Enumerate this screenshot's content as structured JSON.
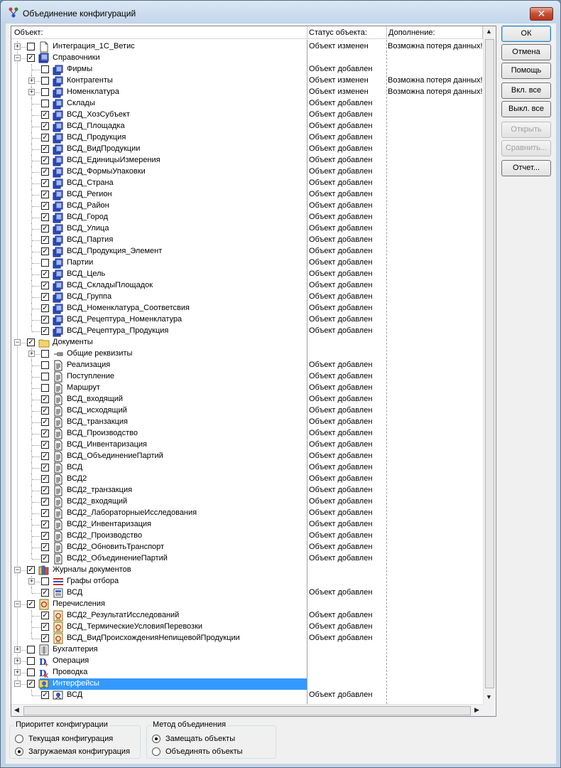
{
  "window": {
    "title": "Объединение конфигураций",
    "close_label": "✕"
  },
  "tree": {
    "columns": [
      "Объект:",
      "Статус объекта:",
      "Дополнение:"
    ],
    "rows": [
      {
        "level": 0,
        "exp": "+",
        "cb": false,
        "icon": "file",
        "name": "Интеграция_1С_Ветис",
        "status": "Объект изменен",
        "extra": "Возможна потеря данных!!"
      },
      {
        "level": 0,
        "exp": "-",
        "cb": true,
        "icon": "catalog-folder",
        "name": "Справочники",
        "status": "",
        "extra": ""
      },
      {
        "level": 1,
        "exp": "",
        "cb": false,
        "icon": "catalog",
        "name": "Фирмы",
        "status": "Объект добавлен",
        "extra": ""
      },
      {
        "level": 1,
        "exp": "+",
        "cb": false,
        "icon": "catalog",
        "name": "Контрагенты",
        "status": "Объект изменен",
        "extra": "Возможна потеря данных!!"
      },
      {
        "level": 1,
        "exp": "+",
        "cb": false,
        "icon": "catalog",
        "name": "Номенклатура",
        "status": "Объект изменен",
        "extra": "Возможна потеря данных!!"
      },
      {
        "level": 1,
        "exp": "",
        "cb": false,
        "icon": "catalog",
        "name": "Склады",
        "status": "Объект добавлен",
        "extra": ""
      },
      {
        "level": 1,
        "exp": "",
        "cb": true,
        "icon": "catalog",
        "name": "ВСД_ХозСубъект",
        "status": "Объект добавлен",
        "extra": ""
      },
      {
        "level": 1,
        "exp": "",
        "cb": true,
        "icon": "catalog",
        "name": "ВСД_Площадка",
        "status": "Объект добавлен",
        "extra": ""
      },
      {
        "level": 1,
        "exp": "",
        "cb": true,
        "icon": "catalog",
        "name": "ВСД_Продукция",
        "status": "Объект добавлен",
        "extra": ""
      },
      {
        "level": 1,
        "exp": "",
        "cb": true,
        "icon": "catalog",
        "name": "ВСД_ВидПродукции",
        "status": "Объект добавлен",
        "extra": ""
      },
      {
        "level": 1,
        "exp": "",
        "cb": true,
        "icon": "catalog",
        "name": "ВСД_ЕдиницыИзмерения",
        "status": "Объект добавлен",
        "extra": ""
      },
      {
        "level": 1,
        "exp": "",
        "cb": true,
        "icon": "catalog",
        "name": "ВСД_ФормыУпаковки",
        "status": "Объект добавлен",
        "extra": ""
      },
      {
        "level": 1,
        "exp": "",
        "cb": true,
        "icon": "catalog",
        "name": "ВСД_Страна",
        "status": "Объект добавлен",
        "extra": ""
      },
      {
        "level": 1,
        "exp": "",
        "cb": true,
        "icon": "catalog",
        "name": "ВСД_Регион",
        "status": "Объект добавлен",
        "extra": ""
      },
      {
        "level": 1,
        "exp": "",
        "cb": true,
        "icon": "catalog",
        "name": "ВСД_Район",
        "status": "Объект добавлен",
        "extra": ""
      },
      {
        "level": 1,
        "exp": "",
        "cb": true,
        "icon": "catalog",
        "name": "ВСД_Город",
        "status": "Объект добавлен",
        "extra": ""
      },
      {
        "level": 1,
        "exp": "",
        "cb": true,
        "icon": "catalog",
        "name": "ВСД_Улица",
        "status": "Объект добавлен",
        "extra": ""
      },
      {
        "level": 1,
        "exp": "",
        "cb": true,
        "icon": "catalog",
        "name": "ВСД_Партия",
        "status": "Объект добавлен",
        "extra": ""
      },
      {
        "level": 1,
        "exp": "",
        "cb": true,
        "icon": "catalog",
        "name": "ВСД_Продукция_Элемент",
        "status": "Объект добавлен",
        "extra": ""
      },
      {
        "level": 1,
        "exp": "",
        "cb": false,
        "icon": "catalog",
        "name": "Партии",
        "status": "Объект добавлен",
        "extra": ""
      },
      {
        "level": 1,
        "exp": "",
        "cb": true,
        "icon": "catalog",
        "name": "ВСД_Цель",
        "status": "Объект добавлен",
        "extra": ""
      },
      {
        "level": 1,
        "exp": "",
        "cb": true,
        "icon": "catalog",
        "name": "ВСД_СкладыПлощадок",
        "status": "Объект добавлен",
        "extra": ""
      },
      {
        "level": 1,
        "exp": "",
        "cb": true,
        "icon": "catalog",
        "name": "ВСД_Группа",
        "status": "Объект добавлен",
        "extra": ""
      },
      {
        "level": 1,
        "exp": "",
        "cb": true,
        "icon": "catalog",
        "name": "ВСД_Номенклатура_Соответсвия",
        "status": "Объект добавлен",
        "extra": ""
      },
      {
        "level": 1,
        "exp": "",
        "cb": true,
        "icon": "catalog",
        "name": "ВСД_Рецептура_Номенклатура",
        "status": "Объект добавлен",
        "extra": ""
      },
      {
        "level": 1,
        "exp": "",
        "cb": true,
        "icon": "catalog",
        "name": "ВСД_Рецептура_Продукция",
        "status": "Объект добавлен",
        "extra": ""
      },
      {
        "level": 0,
        "exp": "-",
        "cb": true,
        "icon": "folder",
        "name": "Документы",
        "status": "",
        "extra": ""
      },
      {
        "level": 1,
        "exp": "+",
        "cb": false,
        "icon": "attribute",
        "name": "Общие реквизиты",
        "status": "",
        "extra": ""
      },
      {
        "level": 1,
        "exp": "",
        "cb": false,
        "icon": "document",
        "name": "Реализация",
        "status": "Объект добавлен",
        "extra": ""
      },
      {
        "level": 1,
        "exp": "",
        "cb": false,
        "icon": "document",
        "name": "Поступление",
        "status": "Объект добавлен",
        "extra": ""
      },
      {
        "level": 1,
        "exp": "",
        "cb": false,
        "icon": "document",
        "name": "Маршрут",
        "status": "Объект добавлен",
        "extra": ""
      },
      {
        "level": 1,
        "exp": "",
        "cb": true,
        "icon": "document",
        "name": "ВСД_входящий",
        "status": "Объект добавлен",
        "extra": ""
      },
      {
        "level": 1,
        "exp": "",
        "cb": true,
        "icon": "document",
        "name": "ВСД_исходящий",
        "status": "Объект добавлен",
        "extra": ""
      },
      {
        "level": 1,
        "exp": "",
        "cb": true,
        "icon": "document",
        "name": "ВСД_транзакция",
        "status": "Объект добавлен",
        "extra": ""
      },
      {
        "level": 1,
        "exp": "",
        "cb": true,
        "icon": "document",
        "name": "ВСД_Производство",
        "status": "Объект добавлен",
        "extra": ""
      },
      {
        "level": 1,
        "exp": "",
        "cb": true,
        "icon": "document",
        "name": "ВСД_Инвентаризация",
        "status": "Объект добавлен",
        "extra": ""
      },
      {
        "level": 1,
        "exp": "",
        "cb": true,
        "icon": "document",
        "name": "ВСД_ОбъединениеПартий",
        "status": "Объект добавлен",
        "extra": ""
      },
      {
        "level": 1,
        "exp": "",
        "cb": true,
        "icon": "document",
        "name": "ВСД",
        "status": "Объект добавлен",
        "extra": ""
      },
      {
        "level": 1,
        "exp": "",
        "cb": true,
        "icon": "document",
        "name": "ВСД2",
        "status": "Объект добавлен",
        "extra": ""
      },
      {
        "level": 1,
        "exp": "",
        "cb": true,
        "icon": "document",
        "name": "ВСД2_транзакция",
        "status": "Объект добавлен",
        "extra": ""
      },
      {
        "level": 1,
        "exp": "",
        "cb": true,
        "icon": "document",
        "name": "ВСД2_входящий",
        "status": "Объект добавлен",
        "extra": ""
      },
      {
        "level": 1,
        "exp": "",
        "cb": true,
        "icon": "document",
        "name": "ВСД2_ЛабораторныеИсследования",
        "status": "Объект добавлен",
        "extra": ""
      },
      {
        "level": 1,
        "exp": "",
        "cb": true,
        "icon": "document",
        "name": "ВСД2_Инвентаризация",
        "status": "Объект добавлен",
        "extra": ""
      },
      {
        "level": 1,
        "exp": "",
        "cb": true,
        "icon": "document",
        "name": "ВСД2_Производство",
        "status": "Объект добавлен",
        "extra": ""
      },
      {
        "level": 1,
        "exp": "",
        "cb": true,
        "icon": "document",
        "name": "ВСД2_ОбновитьТранспорт",
        "status": "Объект добавлен",
        "extra": ""
      },
      {
        "level": 1,
        "exp": "",
        "cb": true,
        "icon": "document",
        "name": "ВСД2_ОбъединениеПартий",
        "status": "Объект добавлен",
        "extra": ""
      },
      {
        "level": 0,
        "exp": "-",
        "cb": true,
        "icon": "journals",
        "name": "Журналы документов",
        "status": "",
        "extra": ""
      },
      {
        "level": 1,
        "exp": "+",
        "cb": false,
        "icon": "selection",
        "name": "Графы отбора",
        "status": "",
        "extra": ""
      },
      {
        "level": 1,
        "exp": "",
        "cb": true,
        "icon": "journal",
        "name": "ВСД",
        "status": "Объект добавлен",
        "extra": ""
      },
      {
        "level": 0,
        "exp": "-",
        "cb": true,
        "icon": "enum-folder",
        "name": "Перечисления",
        "status": "",
        "extra": ""
      },
      {
        "level": 1,
        "exp": "",
        "cb": true,
        "icon": "enum",
        "name": "ВСД2_РезультатИсследований",
        "status": "Объект добавлен",
        "extra": ""
      },
      {
        "level": 1,
        "exp": "",
        "cb": true,
        "icon": "enum",
        "name": "ВСД_ТермическиеУсловияПеревозки",
        "status": "Объект добавлен",
        "extra": ""
      },
      {
        "level": 1,
        "exp": "",
        "cb": true,
        "icon": "enum",
        "name": "ВСД_ВидПроисхожденияНепищевойПродукции",
        "status": "Объект добавлен",
        "extra": ""
      },
      {
        "level": 0,
        "exp": "+",
        "cb": false,
        "icon": "accounting",
        "name": "Бухгалтерия",
        "status": "",
        "extra": ""
      },
      {
        "level": 0,
        "exp": "+",
        "cb": false,
        "icon": "operation",
        "name": "Операция",
        "status": "",
        "extra": ""
      },
      {
        "level": 0,
        "exp": "+",
        "cb": false,
        "icon": "posting",
        "name": "Проводка",
        "status": "",
        "extra": ""
      },
      {
        "level": 0,
        "exp": "-",
        "cb": true,
        "icon": "interfaces",
        "name": "Интерфейсы",
        "status": "",
        "extra": "",
        "selected": true
      },
      {
        "level": 1,
        "exp": "",
        "cb": true,
        "icon": "interface",
        "name": "ВСД",
        "status": "Объект добавлен",
        "extra": ""
      }
    ]
  },
  "buttons": {
    "ok": "ОК",
    "cancel": "Отмена",
    "help": "Помощь",
    "enable_all": "Вкл. все",
    "disable_all": "Выкл. все",
    "open": "Открыть",
    "compare": "Сравнить...",
    "report": "Отчет..."
  },
  "priority_group": {
    "title": "Приоритет конфигурации",
    "options": [
      "Текущая конфигурация",
      "Загружаемая конфигурация"
    ],
    "selected": 1
  },
  "method_group": {
    "title": "Метод объединения",
    "options": [
      "Замещать объекты",
      "Объединять объекты"
    ],
    "selected": 0
  },
  "colors": {
    "selection": "#3399ff",
    "window_frame": "#c3d4e7",
    "close_button": "#c54d33"
  }
}
